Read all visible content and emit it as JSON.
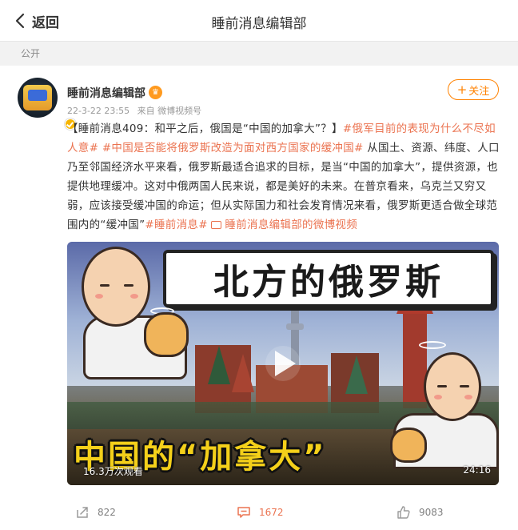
{
  "header": {
    "back_label": "返回",
    "title": "睡前消息编辑部"
  },
  "visibility": "公开",
  "post": {
    "username": "睡前消息编辑部",
    "vip_badge": "♛",
    "timestamp": "22-3-22 23:55",
    "source": "来自 微博视频号",
    "follow_label": "关注",
    "content": {
      "segment_1": "【睡前消息409：和平之后，俄国是“中国的加拿大”？】",
      "hashtag_1": "#俄军目前的表现为什么不尽如人意#",
      "hashtag_2": "#中国是否能将俄罗斯改造为面对西方国家的缓冲国#",
      "segment_2": " 从国土、资源、纬度、人口乃至邻国经济水平来看，俄罗斯最适合追求的目标，是当“中国的加拿大”，提供资源，也提供地理缓冲。这对中俄两国人民来说，都是美好的未来。在普京看来，乌克兰又穷又弱，应该接受缓冲国的命运；但从实际国力和社会发育情况来看，俄罗斯更适合做全球范围内的“缓冲国”",
      "hashtag_3": "#睡前消息#",
      "video_link": "睡前消息编辑部的微博视频"
    },
    "video": {
      "title_top": "北方的俄罗斯",
      "title_bottom": "中国的“加拿大”",
      "views": "16.3万次观看",
      "duration": "24:16"
    },
    "actions": {
      "reposts": "822",
      "comments": "1672",
      "likes": "9083"
    }
  },
  "colors": {
    "accent": "#ff8200",
    "link": "#eb7350",
    "background": "#f2f2f2"
  }
}
